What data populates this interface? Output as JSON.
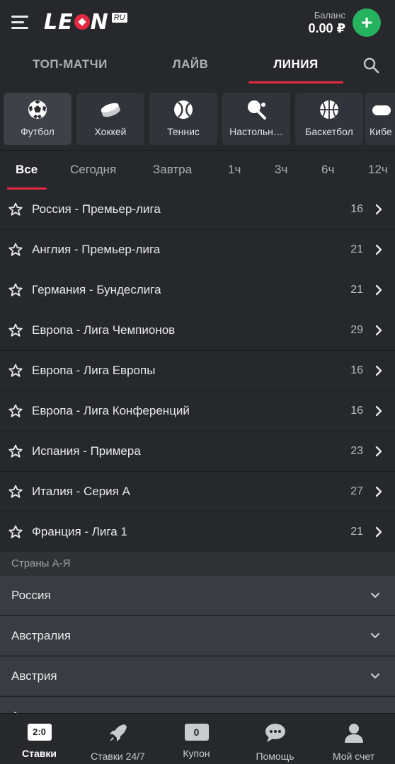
{
  "header": {
    "logo_text": "LEON",
    "logo_suffix": "RU",
    "balance_label": "Баланс",
    "balance_value": "0.00 ₽",
    "add_label": "+"
  },
  "main_tabs": [
    {
      "label": "ТОП-МАТЧИ"
    },
    {
      "label": "ЛАЙВ"
    },
    {
      "label": "ЛИНИЯ",
      "active": true
    }
  ],
  "sports": [
    {
      "label": "Футбол",
      "icon": "football-icon",
      "active": true
    },
    {
      "label": "Хоккей",
      "icon": "hockey-puck-icon"
    },
    {
      "label": "Теннис",
      "icon": "tennis-ball-icon"
    },
    {
      "label": "Настольн…",
      "icon": "table-tennis-icon"
    },
    {
      "label": "Баскетбол",
      "icon": "basketball-icon"
    },
    {
      "label": "Кибе",
      "icon": "esports-icon"
    }
  ],
  "time_filters": [
    {
      "label": "Все",
      "active": true
    },
    {
      "label": "Сегодня"
    },
    {
      "label": "Завтра"
    },
    {
      "label": "1ч"
    },
    {
      "label": "3ч"
    },
    {
      "label": "6ч"
    },
    {
      "label": "12ч"
    }
  ],
  "leagues": [
    {
      "name": "Россия - Премьер-лига",
      "count": "16"
    },
    {
      "name": "Англия - Премьер-лига",
      "count": "21"
    },
    {
      "name": "Германия - Бундеслига",
      "count": "21"
    },
    {
      "name": "Европа - Лига Чемпионов",
      "count": "29"
    },
    {
      "name": "Европа - Лига Европы",
      "count": "16"
    },
    {
      "name": "Европа - Лига Конференций",
      "count": "16"
    },
    {
      "name": "Испания - Примера",
      "count": "23"
    },
    {
      "name": "Италия - Серия А",
      "count": "27"
    },
    {
      "name": "Франция - Лига 1",
      "count": "21"
    }
  ],
  "countries": {
    "title": "Страны А-Я",
    "items": [
      "Россия",
      "Австралия",
      "Австрия",
      "Азия"
    ]
  },
  "bottom_nav": [
    {
      "label": "Ставки",
      "badge": "2:0",
      "active": true
    },
    {
      "label": "Ставки 24/7",
      "icon": "rocket-icon"
    },
    {
      "label": "Купон",
      "badge": "0"
    },
    {
      "label": "Помощь",
      "icon": "chat-bubble-icon"
    },
    {
      "label": "Мой счет",
      "icon": "user-icon"
    }
  ],
  "colors": {
    "accent": "#e3283f",
    "add_button": "#27b25f",
    "background": "#1f2125",
    "panel": "#26282c"
  }
}
